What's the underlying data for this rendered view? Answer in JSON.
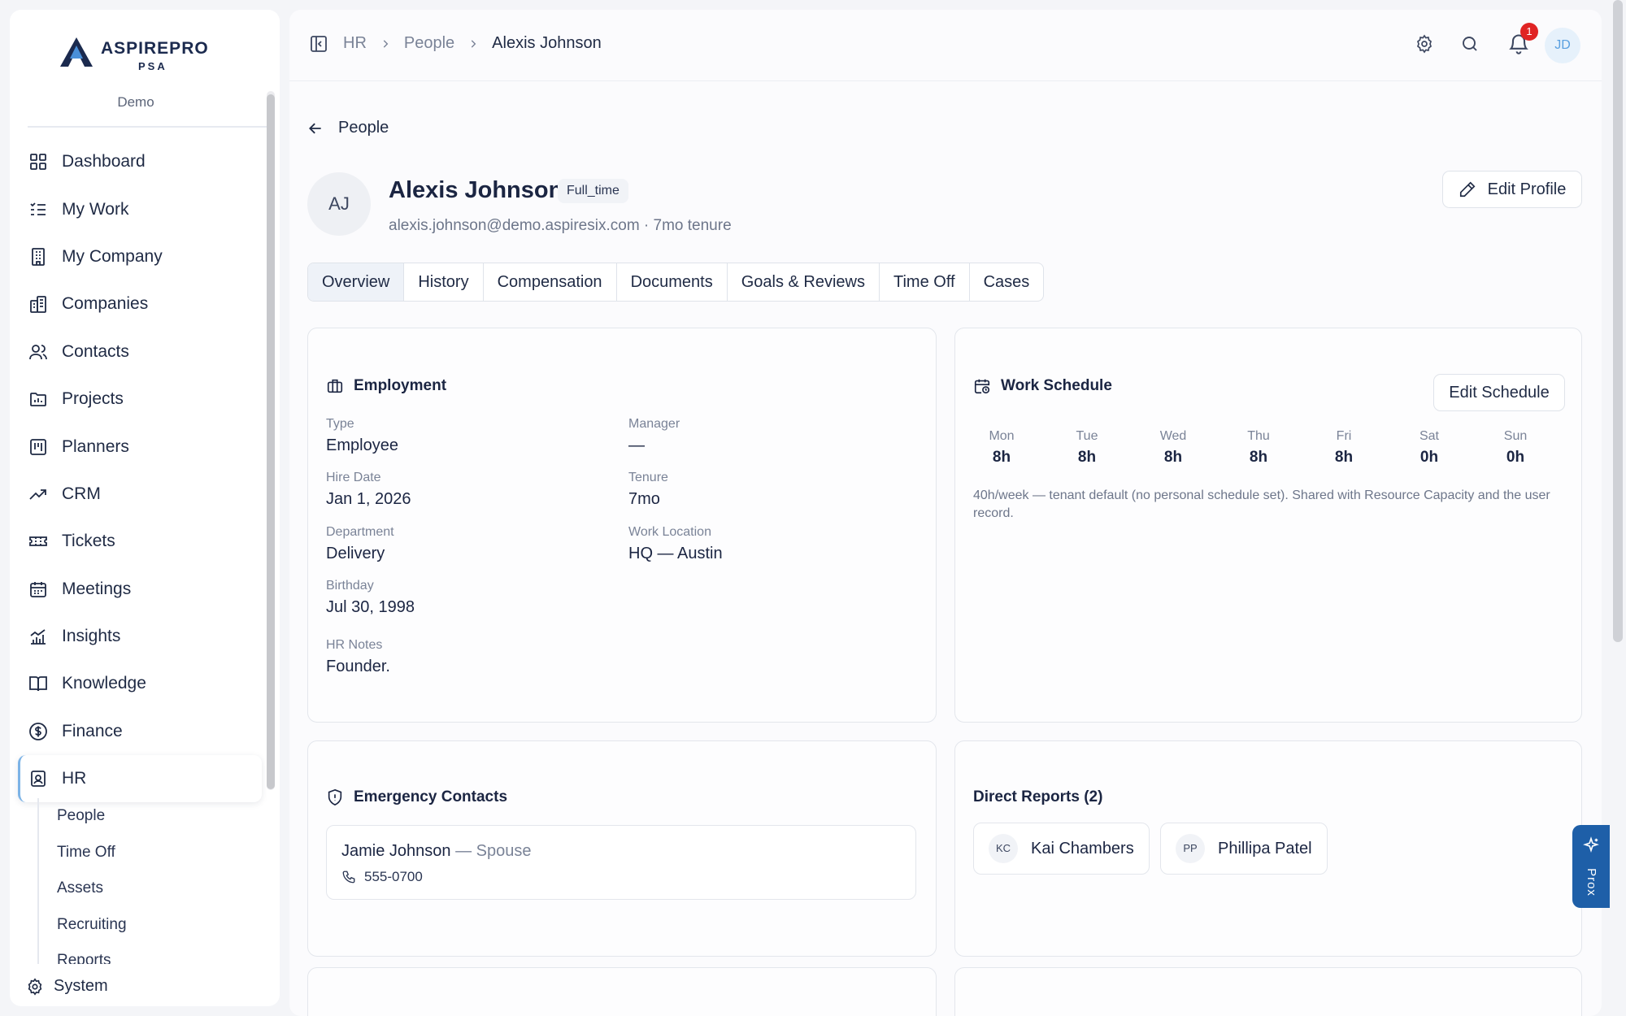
{
  "brand": {
    "name": "ASPIREPRO",
    "sub": "PSA",
    "tenant": "Demo"
  },
  "sidebar": {
    "items": [
      {
        "label": "Dashboard",
        "icon": "dashboard-icon"
      },
      {
        "label": "My Work",
        "icon": "list-check-icon"
      },
      {
        "label": "My Company",
        "icon": "building-icon"
      },
      {
        "label": "Companies",
        "icon": "buildings-icon"
      },
      {
        "label": "Contacts",
        "icon": "users-icon"
      },
      {
        "label": "Projects",
        "icon": "folder-chart-icon"
      },
      {
        "label": "Planners",
        "icon": "kanban-icon"
      },
      {
        "label": "CRM",
        "icon": "trend-up-icon"
      },
      {
        "label": "Tickets",
        "icon": "ticket-icon"
      },
      {
        "label": "Meetings",
        "icon": "calendar-icon"
      },
      {
        "label": "Insights",
        "icon": "bar-chart-icon"
      },
      {
        "label": "Knowledge",
        "icon": "book-icon"
      },
      {
        "label": "Finance",
        "icon": "dollar-icon"
      },
      {
        "label": "HR",
        "icon": "id-badge-icon",
        "active": true
      }
    ],
    "hr_subitems": [
      "People",
      "Time Off",
      "Assets",
      "Recruiting",
      "Reports"
    ],
    "system_label": "System"
  },
  "topbar": {
    "breadcrumb": [
      "HR",
      "People",
      "Alexis Johnson"
    ],
    "notification_count": "1",
    "user_initials": "JD"
  },
  "page": {
    "back_label": "People",
    "person": {
      "initials": "AJ",
      "name": "Alexis Johnson",
      "employment_badge": "Full_time",
      "meta": "alexis.johnson@demo.aspiresix.com · 7mo tenure"
    },
    "edit_profile_label": "Edit Profile",
    "tabs": [
      "Overview",
      "History",
      "Compensation",
      "Documents",
      "Goals & Reviews",
      "Time Off",
      "Cases"
    ],
    "active_tab": "Overview"
  },
  "employment": {
    "title": "Employment",
    "fields": {
      "type": {
        "label": "Type",
        "value": "Employee"
      },
      "manager": {
        "label": "Manager",
        "value": "—"
      },
      "hire_date": {
        "label": "Hire Date",
        "value": "Jan 1, 2026"
      },
      "tenure": {
        "label": "Tenure",
        "value": "7mo"
      },
      "department": {
        "label": "Department",
        "value": "Delivery"
      },
      "work_location": {
        "label": "Work Location",
        "value": "HQ — Austin"
      },
      "birthday": {
        "label": "Birthday",
        "value": "Jul 30, 1998"
      },
      "hr_notes": {
        "label": "HR Notes",
        "value": "Founder."
      }
    }
  },
  "schedule": {
    "title": "Work Schedule",
    "edit_label": "Edit Schedule",
    "days": [
      {
        "day": "Mon",
        "hours": "8h"
      },
      {
        "day": "Tue",
        "hours": "8h"
      },
      {
        "day": "Wed",
        "hours": "8h"
      },
      {
        "day": "Thu",
        "hours": "8h"
      },
      {
        "day": "Fri",
        "hours": "8h"
      },
      {
        "day": "Sat",
        "hours": "0h"
      },
      {
        "day": "Sun",
        "hours": "0h"
      }
    ],
    "note": "40h/week — tenant default (no personal schedule set). Shared with Resource Capacity and the user record."
  },
  "emergency": {
    "title": "Emergency Contacts",
    "contact": {
      "name": "Jamie Johnson",
      "relation": " — Spouse",
      "phone": "555-0700"
    }
  },
  "reports": {
    "title": "Direct Reports (2)",
    "people": [
      {
        "initials": "KC",
        "name": "Kai Chambers"
      },
      {
        "initials": "PP",
        "name": "Phillipa Patel"
      }
    ]
  },
  "assistant": {
    "label": "Prox"
  },
  "colors": {
    "accent": "#1e5fa8",
    "badge": "#e02424",
    "active_border": "#7cb3e6"
  }
}
